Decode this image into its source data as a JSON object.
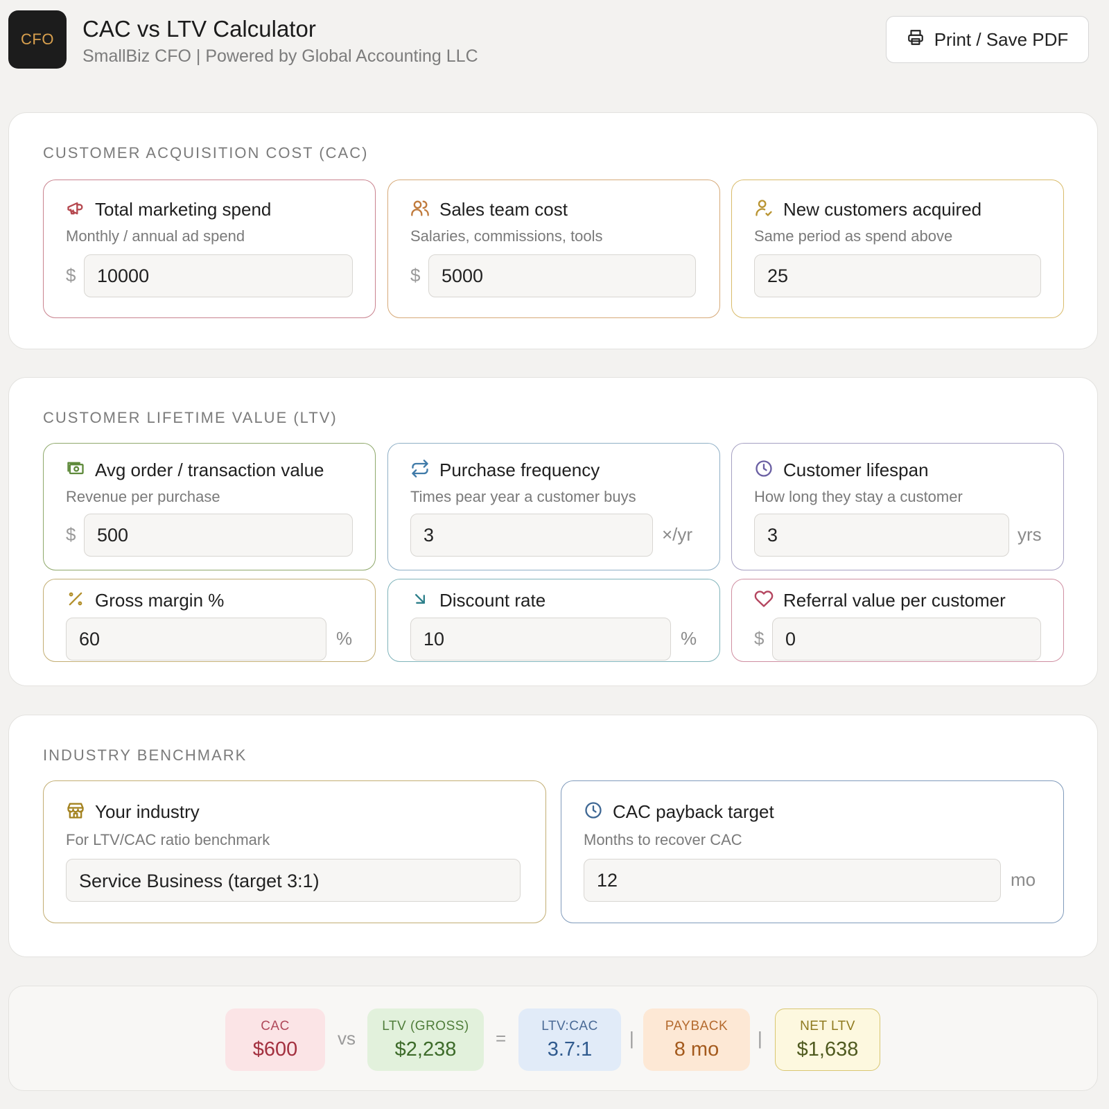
{
  "header": {
    "logo_text": "CFO",
    "title": "CAC vs LTV Calculator",
    "subtitle": "SmallBiz CFO | Powered by Global Accounting LLC",
    "print_label": "Print / Save PDF"
  },
  "cac": {
    "section_title": "CUSTOMER ACQUISITION COST (CAC)",
    "marketing": {
      "label": "Total marketing spend",
      "hint": "Monthly / annual ad spend",
      "prefix": "$",
      "value": "10000"
    },
    "sales": {
      "label": "Sales team cost",
      "hint": "Salaries, commissions, tools",
      "prefix": "$",
      "value": "5000"
    },
    "customers": {
      "label": "New customers acquired",
      "hint": "Same period as spend above",
      "value": "25"
    }
  },
  "ltv": {
    "section_title": "CUSTOMER LIFETIME VALUE (LTV)",
    "aov": {
      "label": "Avg order / transaction value",
      "hint": "Revenue per purchase",
      "prefix": "$",
      "value": "500"
    },
    "frequency": {
      "label": "Purchase frequency",
      "hint": "Times pear year a customer buys",
      "value": "3",
      "suffix": "×/yr"
    },
    "lifespan": {
      "label": "Customer lifespan",
      "hint": "How long they stay a customer",
      "value": "3",
      "suffix": "yrs"
    },
    "margin": {
      "label": "Gross margin %",
      "value": "60",
      "suffix": "%"
    },
    "discount": {
      "label": "Discount rate",
      "value": "10",
      "suffix": "%"
    },
    "referral": {
      "label": "Referral value per customer",
      "prefix": "$",
      "value": "0"
    }
  },
  "benchmark": {
    "section_title": "INDUSTRY BENCHMARK",
    "industry": {
      "label": "Your industry",
      "hint": "For LTV/CAC ratio benchmark",
      "value": "Service Business (target 3:1)"
    },
    "payback": {
      "label": "CAC payback target",
      "hint": "Months to recover CAC",
      "value": "12",
      "suffix": "mo"
    }
  },
  "summary": {
    "cac": {
      "label": "CAC",
      "value": "$600"
    },
    "vs": "vs",
    "ltv": {
      "label": "LTV (GROSS)",
      "value": "$2,238"
    },
    "eq": "=",
    "ratio": {
      "label": "LTV:CAC",
      "value": "3.7:1"
    },
    "bar": "|",
    "payback": {
      "label": "PAYBACK",
      "value": "8 mo"
    },
    "net": {
      "label": "NET LTV",
      "value": "$1,638"
    }
  },
  "colors": {
    "red_border": "#c9828e",
    "orange_border": "#d6a978",
    "gold_border": "#d9bb6a",
    "green_border": "#8ea86a",
    "blue_border": "#8fafc6",
    "purple_border": "#a5a0c2",
    "teal_border": "#7fb3ba",
    "pink_border": "#cf8ea1",
    "olive_border": "#c2ad72",
    "navy_border": "#7f9abb"
  }
}
